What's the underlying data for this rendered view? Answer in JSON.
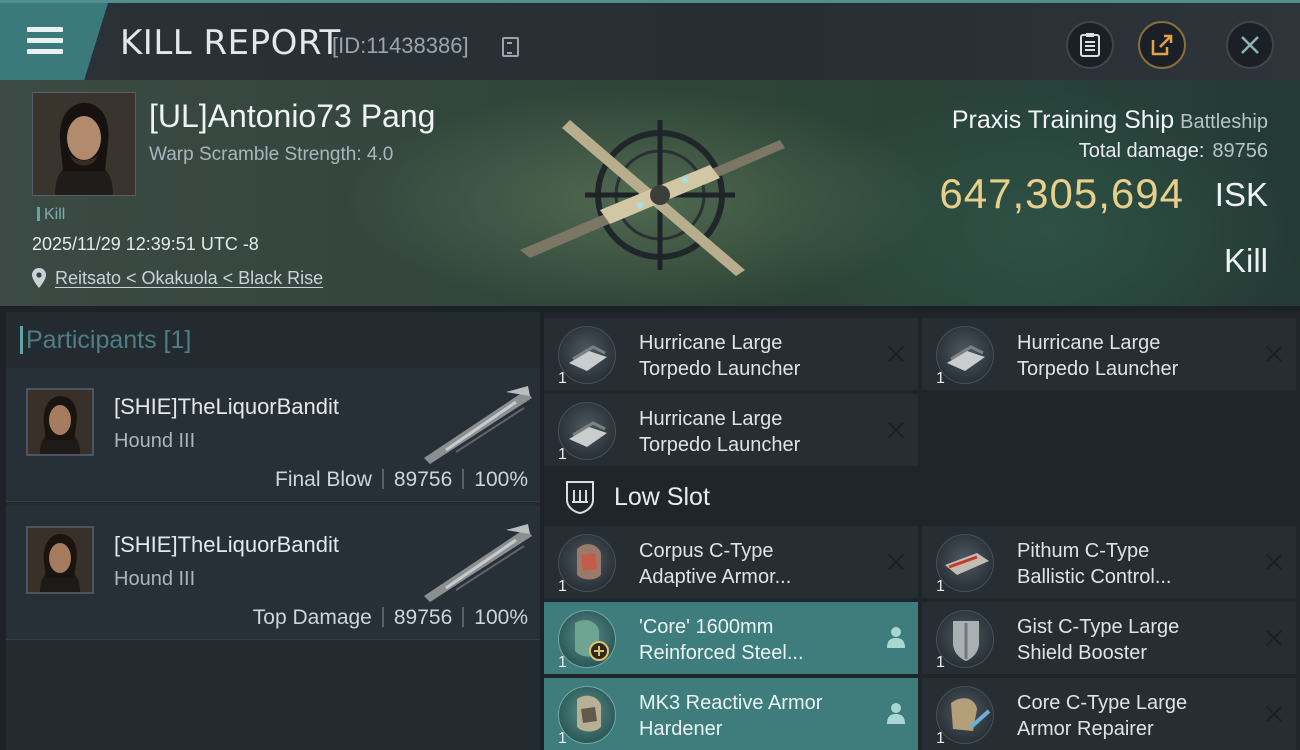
{
  "header": {
    "title": "KILL REPORT",
    "report_id": "[ID:11438386]"
  },
  "victim": {
    "name": "[UL]Antonio73 Pang",
    "warp_scramble": "Warp Scramble Strength: 4.0",
    "tag": "Kill",
    "timestamp": "2025/11/29 12:39:51 UTC -8",
    "location": "Reitsato < Okakuola < Black Rise",
    "ship_name": "Praxis Training Ship",
    "ship_class": "Battleship",
    "total_damage_label": "Total damage:",
    "total_damage": "89756",
    "isk_value": "647,305,694",
    "isk_unit": "ISK",
    "result": "Kill"
  },
  "participants": {
    "title": "Participants [1]",
    "list": [
      {
        "name": "[SHIE]TheLiquorBandit",
        "ship": "Hound III",
        "role": "Final Blow",
        "damage": "89756",
        "percent": "100%"
      },
      {
        "name": "[SHIE]TheLiquorBandit",
        "ship": "Hound III",
        "role": "Top Damage",
        "damage": "89756",
        "percent": "100%"
      }
    ]
  },
  "modules": {
    "high": [
      {
        "line1": "Hurricane Large",
        "line2": "Torpedo Launcher",
        "qty": "1",
        "status": "destroyed",
        "icon": "torpedo-launcher-icon"
      },
      {
        "line1": "Hurricane Large",
        "line2": "Torpedo Launcher",
        "qty": "1",
        "status": "destroyed",
        "icon": "torpedo-launcher-icon"
      },
      {
        "line1": "Hurricane Large",
        "line2": "Torpedo Launcher",
        "qty": "1",
        "status": "destroyed",
        "icon": "torpedo-launcher-icon"
      }
    ],
    "low_slot_label": "Low Slot",
    "low": [
      {
        "line1": "Corpus C-Type",
        "line2": "Adaptive Armor...",
        "qty": "1",
        "status": "destroyed",
        "icon": "armor-hardener-icon"
      },
      {
        "line1": "Pithum C-Type",
        "line2": "Ballistic Control...",
        "qty": "1",
        "status": "destroyed",
        "icon": "ballistic-control-icon"
      },
      {
        "line1": "'Core' 1600mm",
        "line2": "Reinforced Steel...",
        "qty": "1",
        "status": "dropped",
        "icon": "armor-plate-icon"
      },
      {
        "line1": "Gist C-Type Large",
        "line2": "Shield Booster",
        "qty": "1",
        "status": "destroyed",
        "icon": "shield-booster-icon"
      },
      {
        "line1": "MK3 Reactive Armor",
        "line2": "Hardener",
        "qty": "1",
        "status": "dropped",
        "icon": "armor-hardener-icon"
      },
      {
        "line1": "Core C-Type Large",
        "line2": "Armor Repairer",
        "qty": "1",
        "status": "destroyed",
        "icon": "armor-repairer-icon"
      }
    ]
  },
  "colors": {
    "accent": "#3e7d7c",
    "isk_gold": "#e9cf8c",
    "header_teal": "#3a7a7b"
  }
}
